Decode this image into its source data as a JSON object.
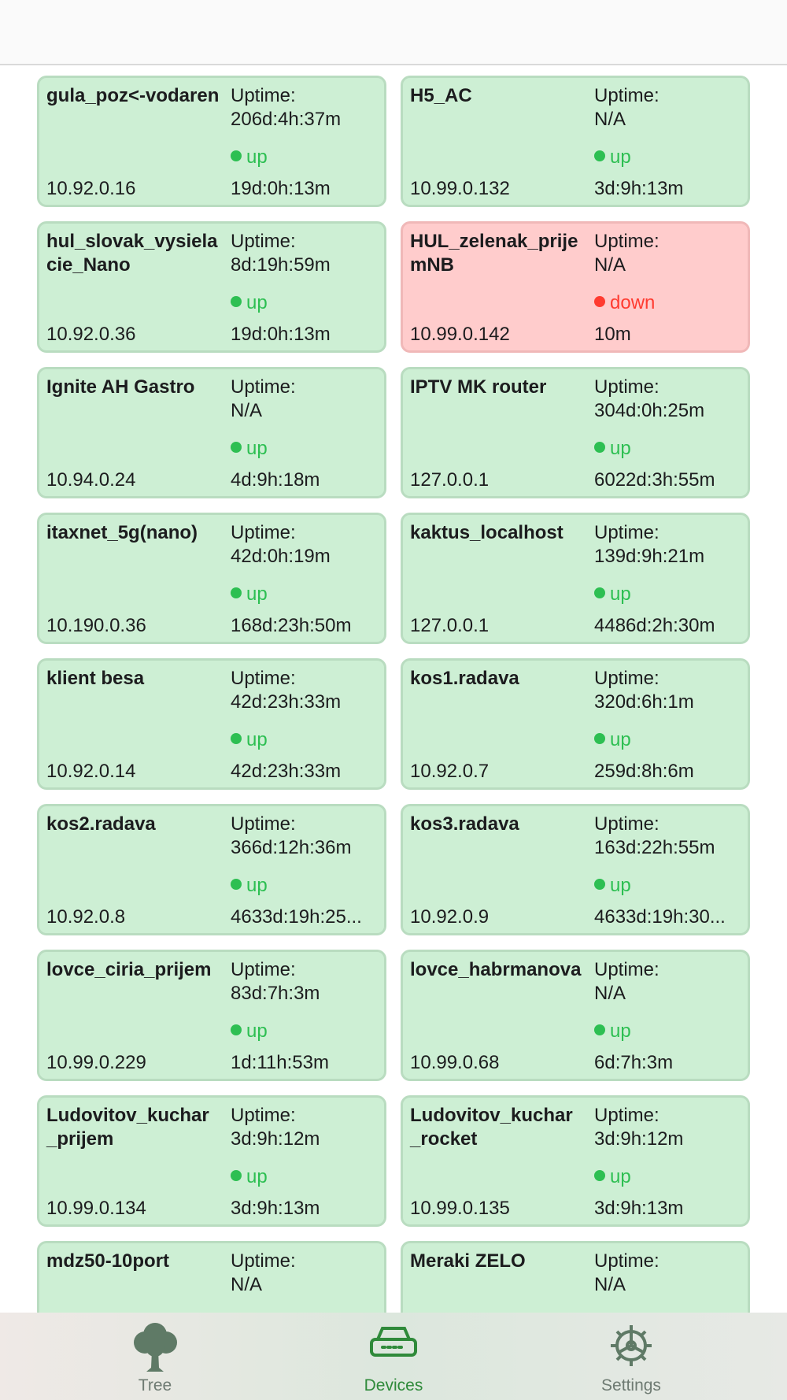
{
  "devices": [
    {
      "name": "gula_poz<-vodaren",
      "uptime_label": "Uptime:",
      "uptime": "206d:4h:37m",
      "status": "up",
      "ip": "10.92.0.16",
      "since": "19d:0h:13m"
    },
    {
      "name": "H5_AC",
      "uptime_label": "Uptime:",
      "uptime": "N/A",
      "status": "up",
      "ip": "10.99.0.132",
      "since": "3d:9h:13m"
    },
    {
      "name": "hul_slovak_vysielacie_Nano",
      "uptime_label": "Uptime:",
      "uptime": "8d:19h:59m",
      "status": "up",
      "ip": "10.92.0.36",
      "since": "19d:0h:13m"
    },
    {
      "name": "HUL_zelenak_prijemNB",
      "uptime_label": "Uptime:",
      "uptime": "N/A",
      "status": "down",
      "ip": "10.99.0.142",
      "since": "10m"
    },
    {
      "name": "Ignite AH Gastro",
      "uptime_label": "Uptime:",
      "uptime": "N/A",
      "status": "up",
      "ip": "10.94.0.24",
      "since": "4d:9h:18m"
    },
    {
      "name": "IPTV MK router",
      "uptime_label": "Uptime:",
      "uptime": "304d:0h:25m",
      "status": "up",
      "ip": "127.0.0.1",
      "since": "6022d:3h:55m"
    },
    {
      "name": "itaxnet_5g(nano)",
      "uptime_label": "Uptime:",
      "uptime": "42d:0h:19m",
      "status": "up",
      "ip": "10.190.0.36",
      "since": "168d:23h:50m"
    },
    {
      "name": "kaktus_localhost",
      "uptime_label": "Uptime:",
      "uptime": "139d:9h:21m",
      "status": "up",
      "ip": "127.0.0.1",
      "since": "4486d:2h:30m"
    },
    {
      "name": "klient besa",
      "uptime_label": "Uptime:",
      "uptime": "42d:23h:33m",
      "status": "up",
      "ip": "10.92.0.14",
      "since": "42d:23h:33m"
    },
    {
      "name": "kos1.radava",
      "uptime_label": "Uptime:",
      "uptime": "320d:6h:1m",
      "status": "up",
      "ip": "10.92.0.7",
      "since": "259d:8h:6m"
    },
    {
      "name": "kos2.radava",
      "uptime_label": "Uptime:",
      "uptime": "366d:12h:36m",
      "status": "up",
      "ip": "10.92.0.8",
      "since": "4633d:19h:25..."
    },
    {
      "name": "kos3.radava",
      "uptime_label": "Uptime:",
      "uptime": "163d:22h:55m",
      "status": "up",
      "ip": "10.92.0.9",
      "since": "4633d:19h:30..."
    },
    {
      "name": "lovce_ciria_prijem",
      "uptime_label": "Uptime:",
      "uptime": "83d:7h:3m",
      "status": "up",
      "ip": "10.99.0.229",
      "since": "1d:11h:53m"
    },
    {
      "name": "lovce_habrmanova",
      "uptime_label": "Uptime:",
      "uptime": "N/A",
      "status": "up",
      "ip": "10.99.0.68",
      "since": "6d:7h:3m"
    },
    {
      "name": "Ludovitov_kuchar_prijem",
      "uptime_label": "Uptime:",
      "uptime": "3d:9h:12m",
      "status": "up",
      "ip": "10.99.0.134",
      "since": "3d:9h:13m"
    },
    {
      "name": "Ludovitov_kuchar_rocket",
      "uptime_label": "Uptime:",
      "uptime": "3d:9h:12m",
      "status": "up",
      "ip": "10.99.0.135",
      "since": "3d:9h:13m"
    },
    {
      "name": "mdz50-10port",
      "uptime_label": "Uptime:",
      "uptime": "N/A"
    },
    {
      "name": "Meraki ZELO",
      "uptime_label": "Uptime:",
      "uptime": "N/A"
    }
  ],
  "tabs": [
    {
      "label": "Tree",
      "icon": "tree-icon",
      "active": false
    },
    {
      "label": "Devices",
      "icon": "router-icon",
      "active": true
    },
    {
      "label": "Settings",
      "icon": "gear-icon",
      "active": false
    }
  ],
  "colors": {
    "card_up_bg": "#cdefd4",
    "card_down_bg": "#ffcccc",
    "status_up": "#2dbf52",
    "status_down": "#ff3b30",
    "tab_active": "#2f8a3a",
    "tab_inactive": "#6e7a72"
  }
}
